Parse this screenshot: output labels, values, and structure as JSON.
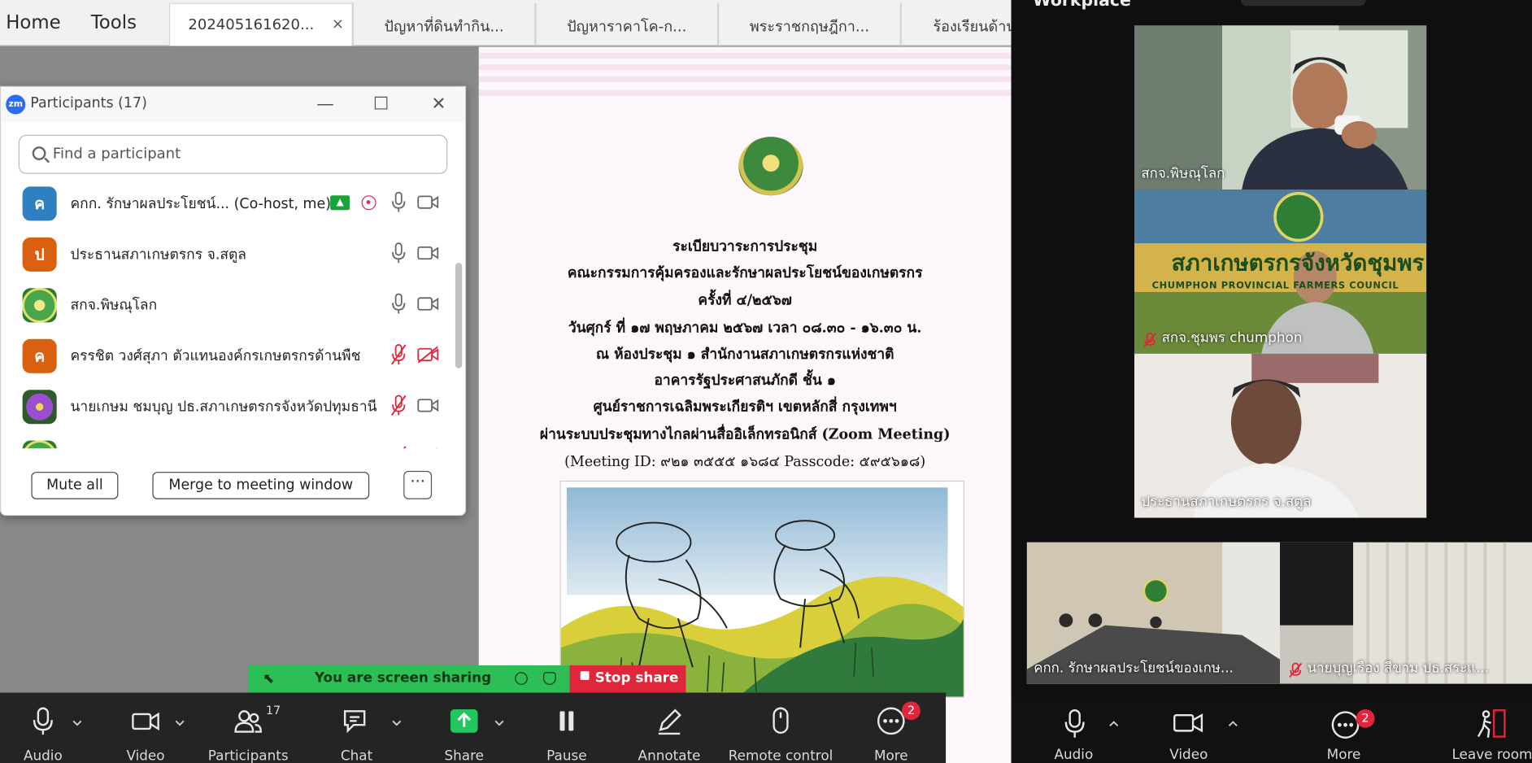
{
  "viewer": {
    "nav": {
      "home": "Home",
      "tools": "Tools"
    },
    "tabs": [
      {
        "label": "202405161620...",
        "close": "×"
      },
      {
        "label": "ปัญหาที่ดินทำกิน..."
      },
      {
        "label": "ปัญหาราคาโค-ก..."
      },
      {
        "label": "พระราชกฤษฎีกา..."
      },
      {
        "label": "ร้องเรียนด้าน"
      }
    ],
    "document": {
      "lines": [
        "ระเบียบวาระการประชุม",
        "คณะกรรมการคุ้มครองและรักษาผลประโยชน์ของเกษตรกร",
        "ครั้งที่ ๔/๒๕๖๗",
        "วันศุกร์ ที่ ๑๗ พฤษภาคม ๒๕๖๗ เวลา ๐๘.๓๐ - ๑๖.๓๐ น.",
        "ณ ห้องประชุม ๑ สำนักงานสภาเกษตรกรแห่งชาติ",
        "อาคารรัฐประศาสนภักดี ชั้น ๑",
        "ศูนย์ราชการเฉลิมพระเกียรติฯ เขตหลักสี่ กรุงเทพฯ",
        "ผ่านระบบประชุมทางไกลผ่านสื่ออิเล็กทรอนิกส์ (Zoom Meeting)",
        "(Meeting ID: ๙๒๑ ๓๕๕๕ ๑๖๘๔ Passcode: ๕๙๕๖๑๘)"
      ]
    }
  },
  "participants_panel": {
    "logo": "zm",
    "title": "Participants (17)",
    "search_placeholder": "Find a participant",
    "participants": [
      {
        "initial": "ค",
        "name": "คกก. รักษาผลประโยชน์... (Co-host, me)",
        "color": "#2f7fc1",
        "avatar": "letter",
        "mic_muted": false,
        "cam_off": false,
        "sharing": true
      },
      {
        "initial": "ป",
        "name": "ประธานสภาเกษตรกร จ.สตูล",
        "color": "#d9600f",
        "avatar": "letter",
        "mic_muted": false,
        "cam_off": false
      },
      {
        "initial": "",
        "name": "สกจ.พิษณุโลก",
        "color": "#3a8f3d",
        "avatar": "logo",
        "mic_muted": false,
        "cam_off": false
      },
      {
        "initial": "ค",
        "name": "ครรชิต วงศ์สุภา ตัวแทนองค์กรเกษตรกรด้านพืช",
        "color": "#d9600f",
        "avatar": "letter",
        "mic_muted": true,
        "cam_off": true
      },
      {
        "initial": "",
        "name": "นายเกษม ชมบุญ ปธ.สภาเกษตรกรจังหวัดปทุมธานี",
        "color": "#7a3fb0",
        "avatar": "flower",
        "mic_muted": true,
        "cam_off": false
      },
      {
        "initial": "",
        "name": "",
        "color": "#3a8f3d",
        "avatar": "logo",
        "mic_muted": true,
        "cam_off": true
      }
    ],
    "buttons": {
      "mute_all": "Mute all",
      "merge": "Merge to meeting window",
      "more": "···"
    }
  },
  "sharing": {
    "status": "You are screen sharing",
    "stop": "Stop share"
  },
  "toolbar": {
    "items": [
      {
        "key": "audio",
        "label": "Audio"
      },
      {
        "key": "video",
        "label": "Video"
      },
      {
        "key": "participants",
        "label": "Participants",
        "count": "17"
      },
      {
        "key": "chat",
        "label": "Chat"
      },
      {
        "key": "share",
        "label": "Share"
      },
      {
        "key": "pause",
        "label": "Pause"
      },
      {
        "key": "annotate",
        "label": "Annotate"
      },
      {
        "key": "remote",
        "label": "Remote control"
      },
      {
        "key": "more",
        "label": "More",
        "badge": "2"
      }
    ]
  },
  "zoom": {
    "header": "Workplace",
    "tiles": [
      {
        "name": "สกจ.พิษณุโลก",
        "muted": false
      },
      {
        "name": "สกจ.ชุมพร chumphon",
        "muted": true,
        "banner": "สภาเกษตรกรจังหวัดชุมพร",
        "banner_sub": "CHUMPHON PROVINCIAL FARMERS COUNCIL"
      },
      {
        "name": "ประธานสภาเกษตรกร จ.สตูล",
        "muted": false
      },
      {
        "name": "คกก. รักษาผลประโยชน์ของเกษ...",
        "muted": false
      },
      {
        "name": "นายบุญเรือง สีขาม ปธ.สระแ...",
        "muted": true
      }
    ],
    "toolbar": {
      "audio": "Audio",
      "video": "Video",
      "more": "More",
      "more_badge": "2",
      "leave": "Leave room"
    }
  }
}
